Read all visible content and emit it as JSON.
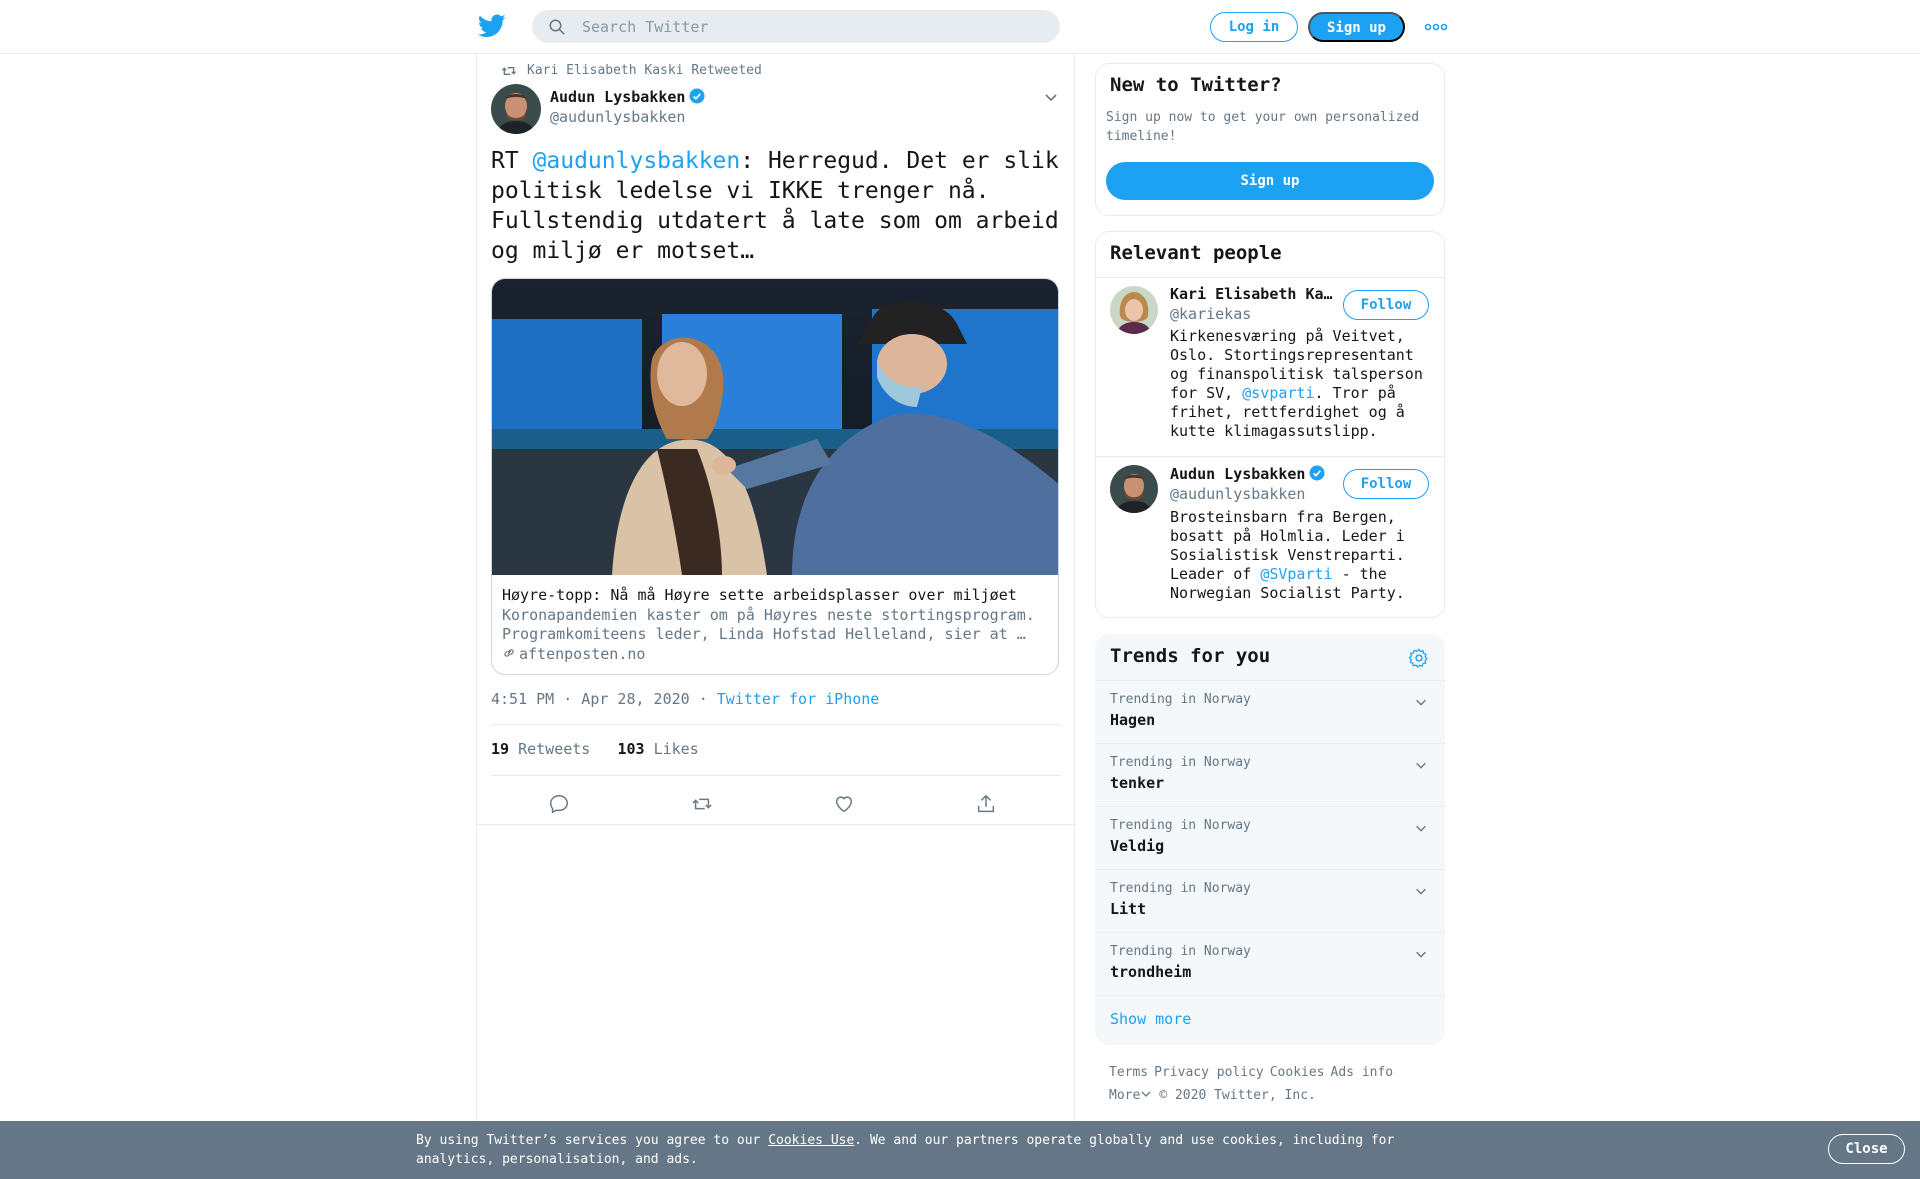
{
  "header": {
    "search_placeholder": "Search Twitter",
    "login_label": "Log in",
    "signup_label": "Sign up"
  },
  "tweet": {
    "retweeted_by": "Kari Elisabeth Kaski Retweeted",
    "author_name": "Audun Lysbakken",
    "author_handle": "@audunlysbakken",
    "text_prefix": "RT ",
    "text_mention": "@audunlysbakken",
    "text_body": ": Herregud. Det er slik politisk ledelse vi IKKE trenger nå. Fullstendig utdatert å late som om arbeid og miljø er motset…",
    "card": {
      "title": "Høyre-topp: Nå må Høyre sette arbeidsplasser over miljøet",
      "description": "Koronapandemien kaster om på Høyres neste stortingsprogram. Programkomiteens leder, Linda Hofstad Helleland, sier at …",
      "domain": "aftenposten.no"
    },
    "timestamp": "4:51 PM · Apr 28, 2020",
    "separator": " · ",
    "source": "Twitter for iPhone",
    "retweets_count": "19",
    "retweets_label": "Retweets",
    "likes_count": "103",
    "likes_label": "Likes"
  },
  "sidebar": {
    "new_to_twitter": {
      "title": "New to Twitter?",
      "text": "Sign up now to get your own personalized timeline!",
      "button": "Sign up"
    },
    "relevant_people": {
      "title": "Relevant people",
      "people": [
        {
          "name": "Kari Elisabeth Kaski",
          "handle": "@kariekas",
          "bio_a": "Kirkenesværing på Veitvet, Oslo. Stortingsrepresentant og finanspolitisk talsperson for SV, ",
          "bio_mention": "@svparti",
          "bio_b": ". Tror på frihet, rettferdighet og å kutte klimagassutslipp.",
          "follow_label": "Follow"
        },
        {
          "name": "Audun Lysbakken",
          "handle": "@audunlysbakken",
          "bio_a": "Brosteinsbarn fra Bergen, bosatt på Holmlia. Leder i Sosialistisk Venstreparti. Leader of ",
          "bio_mention": "@SVparti",
          "bio_b": " - the Norwegian Socialist Party.",
          "follow_label": "Follow"
        }
      ]
    },
    "trends": {
      "title": "Trends for you",
      "items": [
        {
          "context": "Trending in Norway",
          "name": "Hagen"
        },
        {
          "context": "Trending in Norway",
          "name": "tenker"
        },
        {
          "context": "Trending in Norway",
          "name": "Veldig"
        },
        {
          "context": "Trending in Norway",
          "name": "Litt"
        },
        {
          "context": "Trending in Norway",
          "name": "trondheim"
        }
      ],
      "show_more": "Show more"
    },
    "footer": {
      "terms": "Terms",
      "privacy": "Privacy policy",
      "cookies": "Cookies",
      "ads": "Ads info",
      "more": "More",
      "copyright": "© 2020 Twitter, Inc."
    }
  },
  "cookie_banner": {
    "text_a": "By using Twitter’s services you agree to our ",
    "link": "Cookies Use",
    "text_b": ". We and our partners operate globally and use cookies, including for analytics, personalisation, and ads.",
    "close_label": "Close"
  },
  "colors": {
    "brand": "#1da1f2",
    "secondary_text": "#657786",
    "banner": "#657786"
  }
}
